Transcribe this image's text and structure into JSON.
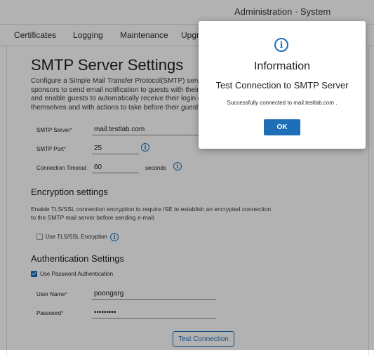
{
  "header": {
    "title": "Administration · System"
  },
  "tabs": [
    {
      "label": "Certificates"
    },
    {
      "label": "Logging"
    },
    {
      "label": "Maintenance"
    },
    {
      "label": "Upgr"
    }
  ],
  "page": {
    "title": "SMTP Server Settings",
    "description_lines": [
      "Configure a Simple Mail Transfer Protocol(SMTP) server t",
      "sponsors to send email notification to guests with their lo",
      "and enable guests to automatically receive their login cre",
      "themselves and with actions to take before their guest ac"
    ]
  },
  "smtp": {
    "server_label": "SMTP Server",
    "server_value": "mail.testlab.com",
    "port_label": "SMTP Port",
    "port_value": "25",
    "required_mark": "*",
    "timeout_label": "Connection Timeout",
    "timeout_value": "60",
    "timeout_unit": "seconds"
  },
  "encryption": {
    "title": "Encryption settings",
    "description_lines": [
      "Enable TLS/SSL connection encryption to require ISE to establish an encrypted connection",
      "to the SMTP mail server before sending e-mail."
    ],
    "tls_label": "Use TLS/SSL Encryption",
    "tls_checked": false
  },
  "authentication": {
    "title": "Authentication Settings",
    "use_password_label": "Use Password Authentication",
    "use_password_checked": true,
    "username_label": "User Name",
    "username_value": "poongarg",
    "password_label": "Password",
    "password_value": "•••••••••"
  },
  "actions": {
    "test_connection_label": "Test Connection"
  },
  "icons": {
    "info": "info-icon"
  },
  "modal": {
    "icon": "i",
    "title": "Information",
    "heading": "Test Connection to SMTP Server",
    "message": "Successfully connected to mail.testlab.com .",
    "ok_label": "OK"
  },
  "colors": {
    "accent": "#1e6fb8",
    "required": "#c0202b",
    "overlay": "rgba(0,0,0,0.30)"
  }
}
